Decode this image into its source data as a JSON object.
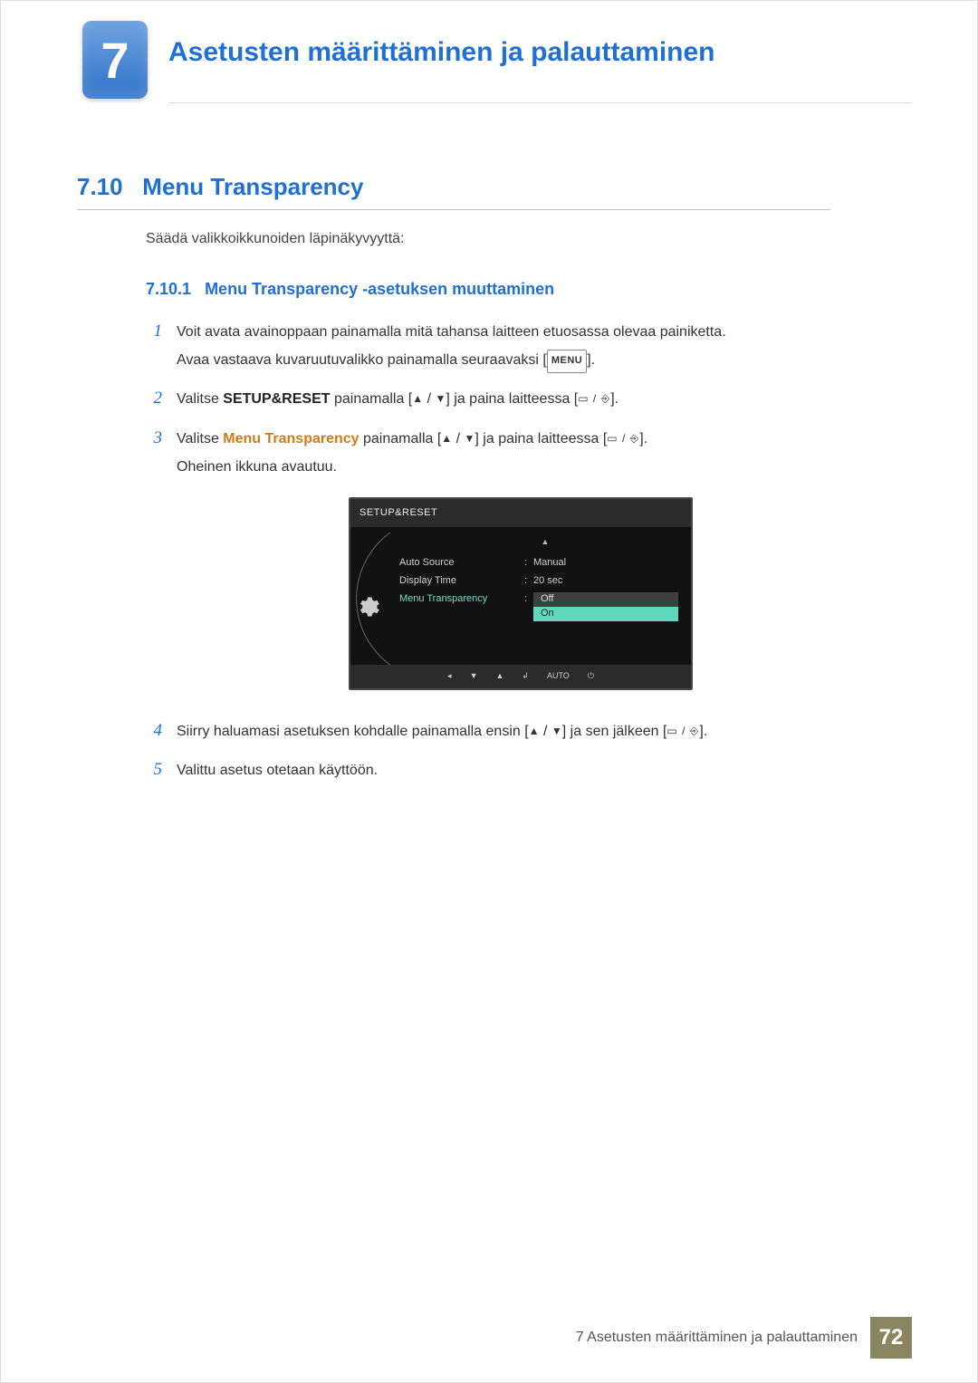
{
  "chapter": {
    "number": "7",
    "title": "Asetusten määrittäminen ja palauttaminen"
  },
  "section": {
    "number": "7.10",
    "title": "Menu Transparency"
  },
  "intro": "Säädä valikkoikkunoiden läpinäkyvyyttä:",
  "subsection": {
    "number": "7.10.1",
    "title": "Menu Transparency -asetuksen muuttaminen"
  },
  "steps": {
    "n1": "1",
    "s1a": "Voit avata avainoppaan painamalla mitä tahansa laitteen etuosassa olevaa painiketta.",
    "s1b_pre": "Avaa vastaava kuvaruutuvalikko painamalla seuraavaksi [",
    "s1b_key": "MENU",
    "s1b_post": "].",
    "n2": "2",
    "s2_pre": "Valitse ",
    "s2_bold": "SETUP&RESET",
    "s2_mid": " painamalla [",
    "s2_mid2": "] ja paina laitteessa [",
    "s2_end": "].",
    "n3": "3",
    "s3_pre": "Valitse ",
    "s3_bold": "Menu Transparency",
    "s3_mid": " painamalla [",
    "s3_mid2": "] ja paina laitteessa [",
    "s3_end": "].",
    "s3_after": "Oheinen ikkuna avautuu.",
    "n4": "4",
    "s4_pre": "Siirry haluamasi asetuksen kohdalle painamalla ensin [",
    "s4_mid": "] ja sen jälkeen [",
    "s4_end": "].",
    "n5": "5",
    "s5": "Valittu asetus otetaan käyttöön."
  },
  "osd": {
    "title": "SETUP&RESET",
    "rows": [
      {
        "label": "Auto Source",
        "value": "Manual",
        "active": false
      },
      {
        "label": "Display Time",
        "value": "20 sec",
        "active": false
      },
      {
        "label": "Menu Transparency",
        "value": "",
        "active": true
      }
    ],
    "options": {
      "off": "Off",
      "on": "On"
    },
    "footer_auto": "AUTO"
  },
  "footer": {
    "chapter_line": "7 Asetusten määrittäminen ja palauttaminen",
    "page": "72"
  },
  "glyphs": {
    "tri_up": "▲",
    "tri_down": "▼",
    "slash": " / ",
    "rect": "▭",
    "enter": "⎆"
  }
}
